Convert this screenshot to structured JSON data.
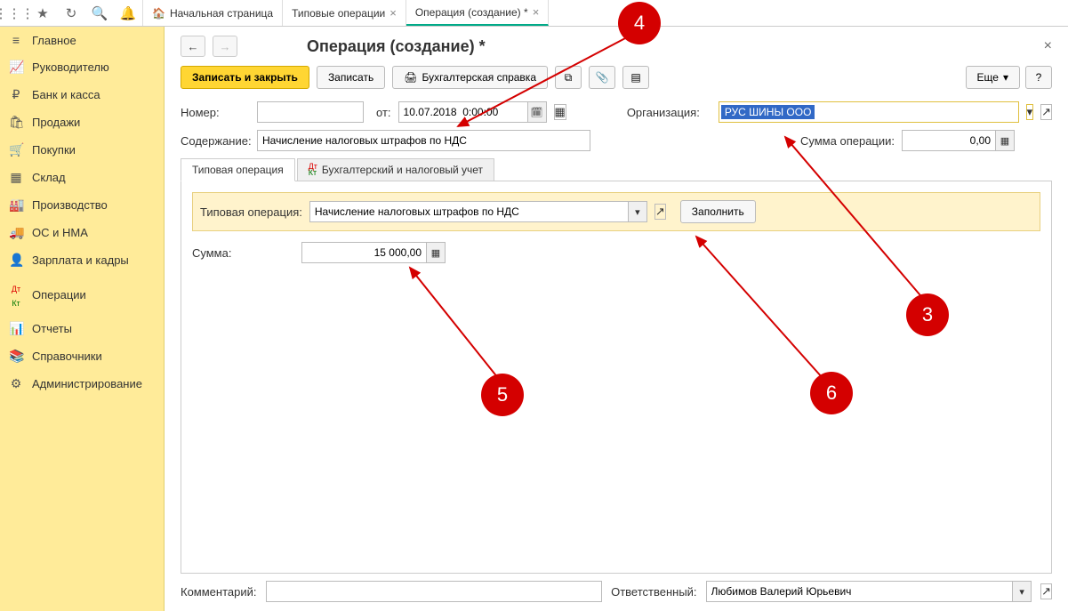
{
  "top_icons": [
    "apps",
    "star",
    "copy",
    "search",
    "bell"
  ],
  "tabs": [
    {
      "label": "Начальная страница",
      "icon": "home",
      "closable": false,
      "active": false
    },
    {
      "label": "Типовые операции",
      "closable": true,
      "active": false
    },
    {
      "label": "Операция (создание) *",
      "closable": true,
      "active": true
    }
  ],
  "sidebar": [
    {
      "label": "Главное",
      "icon": "≡"
    },
    {
      "label": "Руководителю",
      "icon": "📈"
    },
    {
      "label": "Банк и касса",
      "icon": "₽"
    },
    {
      "label": "Продажи",
      "icon": "🛍"
    },
    {
      "label": "Покупки",
      "icon": "🛒"
    },
    {
      "label": "Склад",
      "icon": "▦"
    },
    {
      "label": "Производство",
      "icon": "🏭"
    },
    {
      "label": "ОС и НМА",
      "icon": "🚚"
    },
    {
      "label": "Зарплата и кадры",
      "icon": "👤"
    },
    {
      "label": "Операции",
      "icon": "Дт/Кт"
    },
    {
      "label": "Отчеты",
      "icon": "📊"
    },
    {
      "label": "Справочники",
      "icon": "📚"
    },
    {
      "label": "Администрирование",
      "icon": "⚙"
    }
  ],
  "page": {
    "title": "Операция (создание) *",
    "btn_save_close": "Записать и закрыть",
    "btn_save": "Записать",
    "btn_print": "Бухгалтерская справка",
    "btn_more": "Еще",
    "number_label": "Номер:",
    "number_value": "",
    "date_label": "от:",
    "date_value": "10.07.2018  0:00:00",
    "org_label": "Организация:",
    "org_value": "РУС ШИНЫ ООО",
    "content_label": "Содержание:",
    "content_value": "Начисление налоговых штрафов по НДС",
    "sum_label": "Сумма операции:",
    "sum_value": "0,00",
    "tab1": "Типовая операция",
    "tab2": "Бухгалтерский и налоговый учет",
    "typ_label": "Типовая операция:",
    "typ_value": "Начисление налоговых штрафов по НДС",
    "btn_fill": "Заполнить",
    "amount_label": "Сумма:",
    "amount_value": "15 000,00",
    "comment_label": "Комментарий:",
    "comment_value": "",
    "resp_label": "Ответственный:",
    "resp_value": "Любимов Валерий Юрьевич"
  },
  "callouts": {
    "c3": "3",
    "c4": "4",
    "c5": "5",
    "c6": "6"
  }
}
